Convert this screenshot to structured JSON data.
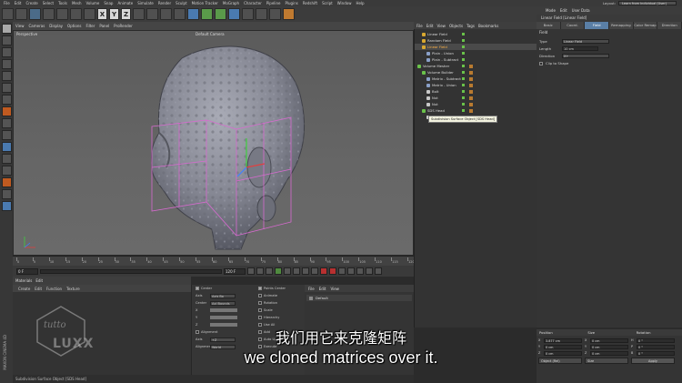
{
  "menubar": {
    "items": [
      "File",
      "Edit",
      "Create",
      "Select",
      "Tools",
      "Mesh",
      "Volume",
      "Snap",
      "Animate",
      "Simulate",
      "Render",
      "Sculpt",
      "Motion Tracker",
      "MoGraph",
      "Character",
      "Pipeline",
      "Plugins",
      "Redshift",
      "Script",
      "Window",
      "Help"
    ],
    "layout_label": "Layout:",
    "layout_value": "Learn from Individual (User)"
  },
  "toolbar": {
    "xyz": [
      "X",
      "Y",
      "Z"
    ]
  },
  "viewport": {
    "menu": [
      "View",
      "Cameras",
      "Display",
      "Options",
      "Filter",
      "Panel",
      "ProRender"
    ],
    "label": "Perspective",
    "camera": "Default Camera"
  },
  "timeline": {
    "ticks": [
      "0",
      "5",
      "10",
      "15",
      "20",
      "25",
      "30",
      "35",
      "40",
      "45",
      "50",
      "55",
      "60",
      "65",
      "70",
      "75",
      "80",
      "85",
      "90",
      "95",
      "100",
      "105",
      "110",
      "115",
      "120"
    ],
    "current_frame": "0 F",
    "start_frame": "0 F",
    "end_frame": "120 F",
    "end_frame2": "120 F"
  },
  "material_panel": {
    "menu_tabs": [
      "Materials",
      "Edit"
    ],
    "bar": [
      "Create",
      "Edit",
      "Function",
      "Texture"
    ]
  },
  "attrs_mid": {
    "rows": [
      {
        "label": "Center",
        "checked": true
      },
      {
        "label": "Axis",
        "value": "Axis Bo"
      },
      {
        "label": "Center",
        "value": "Axi Bounds"
      },
      {
        "label": "X"
      },
      {
        "label": "Y"
      },
      {
        "label": "Z"
      },
      {
        "label": "Alignment",
        "checked": false
      },
      {
        "label": "Axis",
        "value": "+Z"
      },
      {
        "label": "Alignment",
        "value": "World"
      }
    ],
    "right_rows": [
      "Points Center",
      "Animate",
      "Rotation",
      "Scale",
      "Hierarchy",
      "Use All",
      "Add",
      "Auto Update",
      "Execute"
    ]
  },
  "layers": {
    "menu": [
      "File",
      "Edit",
      "View"
    ],
    "row_label": "Default"
  },
  "object_manager": {
    "menu": [
      "File",
      "Edit",
      "View",
      "Objects",
      "Tags",
      "Bookmarks"
    ],
    "objects": [
      {
        "name": "Linear Field",
        "indent": 1,
        "color": "#d9a830",
        "selected": false
      },
      {
        "name": "Random Field",
        "indent": 1,
        "color": "#d9a830",
        "selected": false
      },
      {
        "name": "Linear Field",
        "indent": 1,
        "color": "#d9a830",
        "selected": true
      },
      {
        "name": "Plain - Union",
        "indent": 2,
        "color": "#8aa0c8",
        "selected": false
      },
      {
        "name": "Plain - Subtract",
        "indent": 2,
        "color": "#8aa0c8",
        "selected": false
      },
      {
        "name": "Volume Mesher",
        "indent": 0,
        "color": "#6ac24a",
        "selected": false
      },
      {
        "name": "Volume Builder",
        "indent": 1,
        "color": "#6ac24a",
        "selected": false
      },
      {
        "name": "Matrix - Subtract",
        "indent": 2,
        "color": "#8aa0c8",
        "selected": false
      },
      {
        "name": "Matrix - Union",
        "indent": 2,
        "color": "#8aa0c8",
        "selected": false
      },
      {
        "name": "Bolt",
        "indent": 2,
        "color": "#c8c8c8",
        "selected": false
      },
      {
        "name": "Nut",
        "indent": 2,
        "color": "#c8c8c8",
        "selected": false
      },
      {
        "name": "Nut",
        "indent": 2,
        "color": "#c8c8c8",
        "selected": false
      },
      {
        "name": "SDS Head",
        "indent": 1,
        "color": "#6ac24a",
        "selected": false
      },
      {
        "name": "Head",
        "indent": 2,
        "color": "#c8c8c8",
        "selected": false
      }
    ],
    "tooltip": "Subdivision Surface Object [SDS Head]"
  },
  "attribute_manager": {
    "menu": [
      "Mode",
      "Edit",
      "User Data"
    ],
    "title": "Linear Field [Linear Field]",
    "tabs": [
      "Basic",
      "Coord.",
      "Field",
      "Remapping",
      "Color Remap",
      "Direction"
    ],
    "active_tab": "Field",
    "section": "Field",
    "rows": [
      {
        "label": "Type",
        "value": "Linear Field",
        "kind": "dropdown"
      },
      {
        "label": "Length",
        "value": "10 cm",
        "kind": "field"
      },
      {
        "label": "Direction",
        "value": "X+",
        "kind": "dropdown"
      },
      {
        "label": "Clip to Shape",
        "value": "",
        "kind": "check"
      }
    ]
  },
  "coordinates": {
    "headers": [
      "Position",
      "Size",
      "Rotation"
    ],
    "rows": [
      {
        "axis": [
          "X",
          "X",
          "H"
        ],
        "values": [
          "3.877 cm",
          "0 cm",
          "0 °"
        ]
      },
      {
        "axis": [
          "Y",
          "Y",
          "P"
        ],
        "values": [
          "0 cm",
          "0 cm",
          "0 °"
        ]
      },
      {
        "axis": [
          "Z",
          "Z",
          "B"
        ],
        "values": [
          "0 cm",
          "0 cm",
          "0 °"
        ]
      }
    ],
    "footer": [
      "Object (Rel)",
      "Size",
      "Apply"
    ]
  },
  "status": {
    "text": "Subdivision Surface Object [SDS Head]",
    "vertical_brand": "MAXON CINEMA 4D"
  },
  "subtitles": {
    "zh": "我们用它来克隆矩阵",
    "en": "we cloned matrices over it."
  },
  "watermark": {
    "text": "LUXX",
    "script": "tutto"
  },
  "colors": {
    "accent": "#5a7fa6",
    "selection": "#ffb347",
    "cloner_box": "#d86ad0",
    "head_mesh": "#8c8e9a"
  }
}
